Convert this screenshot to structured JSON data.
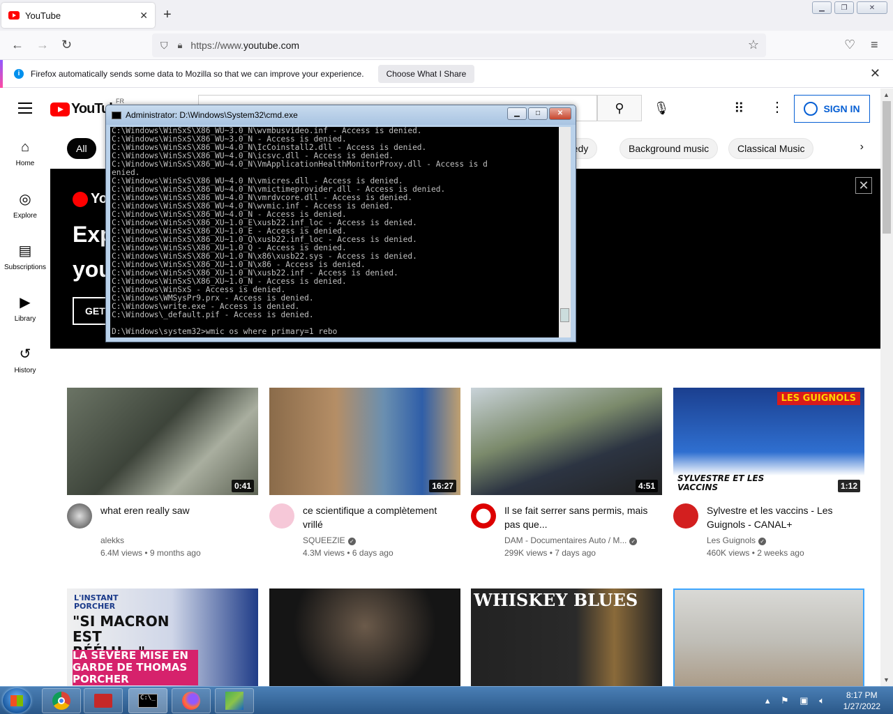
{
  "browser": {
    "tab_title": "YouTube",
    "url_prefix": "https://www.",
    "url_host": "youtube.com",
    "notification_text": "Firefox automatically sends some data to Mozilla so that we can improve your experience.",
    "notification_button": "Choose What I Share"
  },
  "youtube": {
    "logo_text": "YouTube",
    "country_code": "FR",
    "sign_in": "SIGN IN",
    "sidebar": [
      {
        "label": "Home",
        "icon": "home-icon"
      },
      {
        "label": "Explore",
        "icon": "compass-icon"
      },
      {
        "label": "Subscriptions",
        "icon": "subscriptions-icon"
      },
      {
        "label": "Library",
        "icon": "library-icon"
      },
      {
        "label": "History",
        "icon": "history-icon"
      }
    ],
    "chips": [
      "All",
      "medy",
      "Background music",
      "Classical Music"
    ],
    "banner": {
      "logo": "You",
      "line1": "Exp",
      "line2": "you",
      "button": "GET"
    },
    "videos": [
      {
        "title": "what eren really saw",
        "channel": "alekks",
        "views": "6.4M views",
        "age": "9 months ago",
        "duration": "0:41",
        "verified": false
      },
      {
        "title": "ce scientifique a complètement vrillé",
        "channel": "SQUEEZIE",
        "views": "4.3M views",
        "age": "6 days ago",
        "duration": "16:27",
        "verified": true
      },
      {
        "title": "Il se fait serrer sans permis, mais pas que...",
        "channel": "DAM - Documentaires Auto / M...",
        "views": "299K views",
        "age": "7 days ago",
        "duration": "4:51",
        "verified": true
      },
      {
        "title": "Sylvestre et les vaccins - Les Guignols - CANAL+",
        "channel": "Les Guignols",
        "views": "460K views",
        "age": "2 weeks ago",
        "duration": "1:12",
        "verified": true
      }
    ],
    "row2_thumbs": {
      "t1_tag": "L'INSTANT PORCHER",
      "t1_quote": "\"SI MACRON EST RÉÉLU...\"",
      "t1_sub": "LA SÉVÈRE MISE EN GARDE DE THOMAS PORCHER",
      "t3_title": "WHISKEY BLUES",
      "t4_overlay": "LES GUIGNOLS",
      "t4_caption": "SYLVESTRE ET LES VACCINS"
    }
  },
  "cmd": {
    "title": "Administrator: D:\\Windows\\System32\\cmd.exe",
    "lines": [
      "C:\\Windows\\WinSxS\\X86_WU~3.0_N\\wvmbusvideo.inf - Access is denied.",
      "C:\\Windows\\WinSxS\\X86_WU~3.0_N - Access is denied.",
      "C:\\Windows\\WinSxS\\X86_WU~4.0_N\\IcCoinstall2.dll - Access is denied.",
      "C:\\Windows\\WinSxS\\X86_WU~4.0_N\\icsvc.dll - Access is denied.",
      "C:\\Windows\\WinSxS\\X86_WU~4.0_N\\VmApplicationHealthMonitorProxy.dll - Access is d",
      "enied.",
      "C:\\Windows\\WinSxS\\X86_WU~4.0_N\\vmicres.dll - Access is denied.",
      "C:\\Windows\\WinSxS\\X86_WU~4.0_N\\vmictimeprovider.dll - Access is denied.",
      "C:\\Windows\\WinSxS\\X86_WU~4.0_N\\vmrdvcore.dll - Access is denied.",
      "C:\\Windows\\WinSxS\\X86_WU~4.0_N\\wvmic.inf - Access is denied.",
      "C:\\Windows\\WinSxS\\X86_WU~4.0_N - Access is denied.",
      "C:\\Windows\\WinSxS\\X86_XU~1.0_E\\xusb22.inf_loc - Access is denied.",
      "C:\\Windows\\WinSxS\\X86_XU~1.0_E - Access is denied.",
      "C:\\Windows\\WinSxS\\X86_XU~1.0_Q\\xusb22.inf_loc - Access is denied.",
      "C:\\Windows\\WinSxS\\X86_XU~1.0_Q - Access is denied.",
      "C:\\Windows\\WinSxS\\X86_XU~1.0_N\\x86\\xusb22.sys - Access is denied.",
      "C:\\Windows\\WinSxS\\X86_XU~1.0_N\\x86 - Access is denied.",
      "C:\\Windows\\WinSxS\\X86_XU~1.0_N\\xusb22.inf - Access is denied.",
      "C:\\Windows\\WinSxS\\X86_XU~1.0_N - Access is denied.",
      "C:\\Windows\\WinSxS - Access is denied.",
      "C:\\Windows\\WMSysPr9.prx - Access is denied.",
      "C:\\Windows\\write.exe - Access is denied.",
      "C:\\Windows\\_default.pif - Access is denied.",
      "",
      "D:\\Windows\\system32>wmic os where primary=1 rebo"
    ]
  },
  "taskbar": {
    "time": "8:17 PM",
    "date": "1/27/2022"
  }
}
